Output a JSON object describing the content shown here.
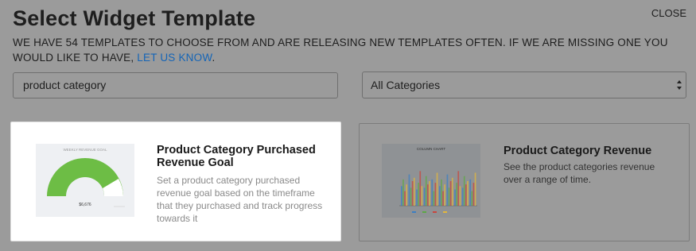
{
  "header": {
    "title": "Select Widget Template",
    "close_label": "CLOSE",
    "intro_text": "WE HAVE 54 TEMPLATES TO CHOOSE FROM AND ARE RELEASING NEW TEMPLATES OFTEN. IF WE ARE MISSING ONE YOU WOULD LIKE TO HAVE, ",
    "intro_link": "LET US KNOW",
    "intro_end": "."
  },
  "search": {
    "value": "product category"
  },
  "category_select": {
    "selected": "All Categories"
  },
  "templates": [
    {
      "title": "Product Category Purchased Revenue Goal",
      "description": "Set a product category purchased revenue goal based on the timeframe that they purchased and track progress towards it",
      "thumbnail": {
        "type": "gauge",
        "heading": "WEEKLY REVENUE GOAL",
        "value_label": "$6,676",
        "fill_fraction": 0.9,
        "color": "#6dbd45"
      },
      "selected": true
    },
    {
      "title": "Product Category Revenue",
      "description": "See the product categories revenue over a range of time.",
      "thumbnail": {
        "type": "column-chart",
        "heading": "COLUMN CHART",
        "series_colors": [
          "#3b7fc4",
          "#5da845",
          "#c9463d",
          "#e3b73c"
        ]
      },
      "selected": false
    }
  ],
  "colors": {
    "overlay": "#9b9b9b",
    "link": "#1565b7",
    "gauge_fill": "#6dbd45"
  }
}
